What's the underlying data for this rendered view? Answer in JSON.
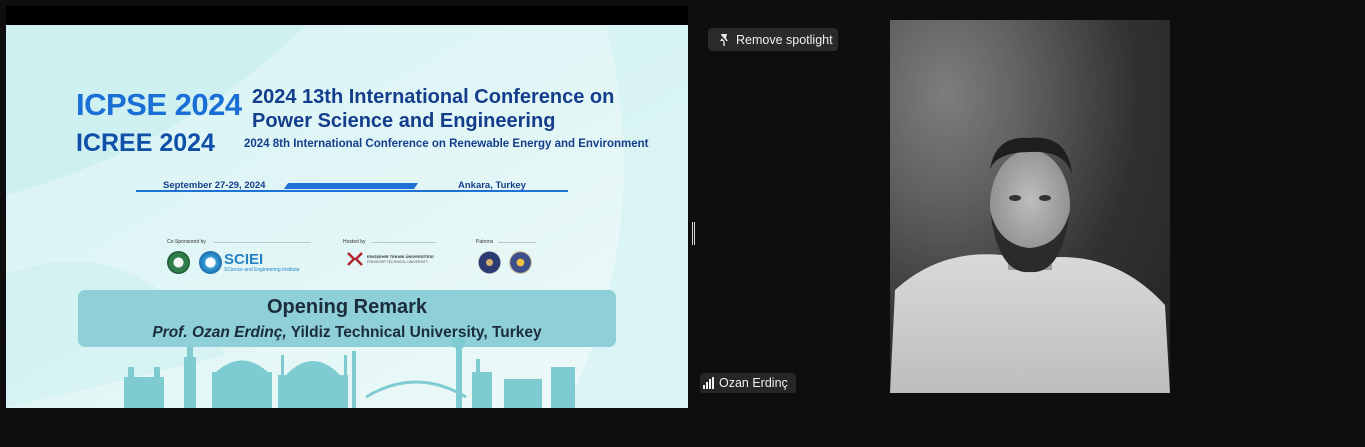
{
  "slide": {
    "logo_primary": "ICPSE 2024",
    "logo_secondary": "ICREE 2024",
    "conference_title": "2024 13th International Conference on Power Science and Engineering",
    "conference_subtitle": "2024 8th International Conference on Renewable Energy and Environment",
    "date": "September 27-29, 2024",
    "location": "Ankara, Turkey",
    "cosponsored_label": "Co-Sponsored by",
    "hosted_label": "Hosted by",
    "patrons_label": "Patrons",
    "sciei_name": "SCIEI",
    "sciei_full": "SCience and Engineering Institute",
    "host_university": "ESKİŞEHİR TEKNİK ÜNİVERSİTESİ",
    "host_university_en": "ESKISEHIR TECHNICAL UNIVERSITY",
    "remark_title": "Opening Remark",
    "speaker_name": "Prof. Ozan Erdinç,",
    "speaker_affiliation": "Yildiz Technical University, Turkey"
  },
  "spotlight": {
    "button_label": "Remove spotlight",
    "icon": "pin-icon"
  },
  "participant": {
    "name": "Ozan Erdinç",
    "icon": "signal-strength-icon"
  },
  "colors": {
    "background": "#0e0e0e",
    "slide_bg": "#e3f6f5",
    "accent_blue": "#1a6fd6",
    "remark_box": "#8ecfd8"
  }
}
